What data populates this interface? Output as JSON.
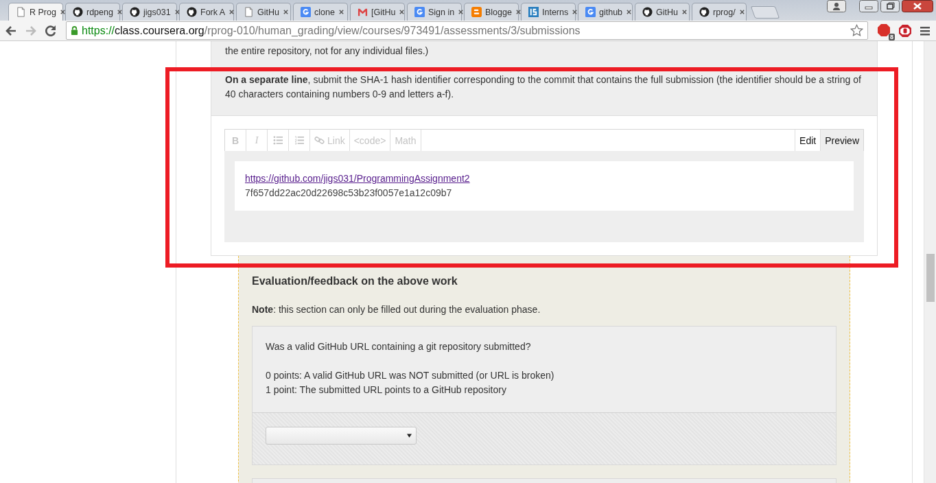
{
  "tabs": [
    {
      "title": "R Prog",
      "selected": true
    },
    {
      "title": "rdpeng",
      "selected": false
    },
    {
      "title": "jigs031",
      "selected": false
    },
    {
      "title": "Fork A",
      "selected": false
    },
    {
      "title": "GitHu",
      "selected": false
    },
    {
      "title": "clone",
      "selected": false
    },
    {
      "title": "[GitHu",
      "selected": false
    },
    {
      "title": "Sign in",
      "selected": false
    },
    {
      "title": "Blogge",
      "selected": false
    },
    {
      "title": "Interns",
      "selected": false
    },
    {
      "title": "github",
      "selected": false
    },
    {
      "title": "GitHu",
      "selected": false
    },
    {
      "title": "rprog/",
      "selected": false
    }
  ],
  "address": {
    "scheme": "https://",
    "host": "class.coursera.org",
    "path": "/rprog-010/human_grading/view/courses/973491/assessments/3/submissions"
  },
  "adblock_badge": "8",
  "instructions": [
    "the entire repository, not for any individual files.)",
    "**On a separate line**, submit the SHA-1 hash identifier corresponding to the commit that contains the full submission (the identifier should be a string of 40 characters containing numbers 0-9 and letters a-f)."
  ],
  "editor": {
    "toolbar": [
      {
        "kind": "bold",
        "label": "B",
        "disabled": true
      },
      {
        "kind": "italic",
        "label": "I",
        "disabled": true
      },
      {
        "kind": "bullets",
        "disabled": true
      },
      {
        "kind": "numbers",
        "disabled": true
      },
      {
        "kind": "link",
        "label": "Link",
        "disabled": true
      },
      {
        "kind": "text",
        "label": "<code>",
        "disabled": true
      },
      {
        "kind": "text",
        "label": "Math",
        "disabled": true
      }
    ],
    "modes": [
      {
        "label": "Edit",
        "selected": false
      },
      {
        "label": "Preview",
        "selected": true
      }
    ],
    "link": "https://github.com/jigs031/ProgrammingAssignment2",
    "hash": "7f657dd22ac20d22698c53b23f0057e1a12c09b7"
  },
  "evaluation": {
    "heading": "Evaluation/feedback on the above work",
    "note": "**Note**: this section can only be filled out during the evaluation phase.",
    "question": "Was a valid GitHub URL containing a git repository submitted?",
    "criteria": [
      "0 points: A valid GitHub URL was NOT submitted (or URL is broken)",
      "1 point: The submitted URL points to a GitHub repository"
    ]
  }
}
